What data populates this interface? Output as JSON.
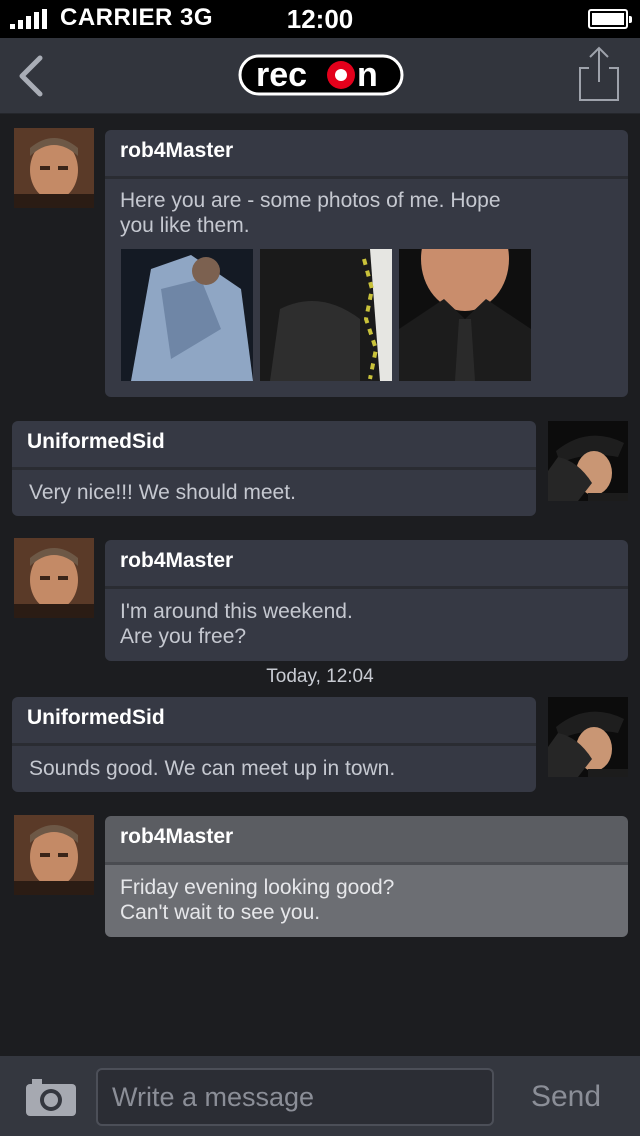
{
  "status_bar": {
    "carrier": "CARRIER 3G",
    "time": "12:00"
  },
  "nav": {
    "logo_text": "recon",
    "back_icon": "chevron-left-icon",
    "share_icon": "share-icon"
  },
  "messages": [
    {
      "sender": "rob4Master",
      "side": "left",
      "text": "Here you are - some photos of me. Hope you like them.",
      "photo_count": 3
    },
    {
      "sender": "UniformedSid",
      "side": "right",
      "text": "Very nice!!! We should meet."
    },
    {
      "sender": "rob4Master",
      "side": "left",
      "text": "I'm around this weekend.\nAre you free?"
    },
    {
      "sender": "UniformedSid",
      "side": "right",
      "text": "Sounds good. We can meet up in town."
    },
    {
      "sender": "rob4Master",
      "side": "left",
      "text": "Friday evening looking good?\nCan't wait to see you."
    }
  ],
  "timestamp": "Today, 12:04",
  "composer": {
    "placeholder": "Write a message",
    "send_label": "Send",
    "camera_icon": "camera-icon"
  },
  "colors": {
    "background": "#1c1d20",
    "bubble": "#363944",
    "highlight_bubble": "#6c6e73",
    "logo_red": "#e3001b"
  }
}
